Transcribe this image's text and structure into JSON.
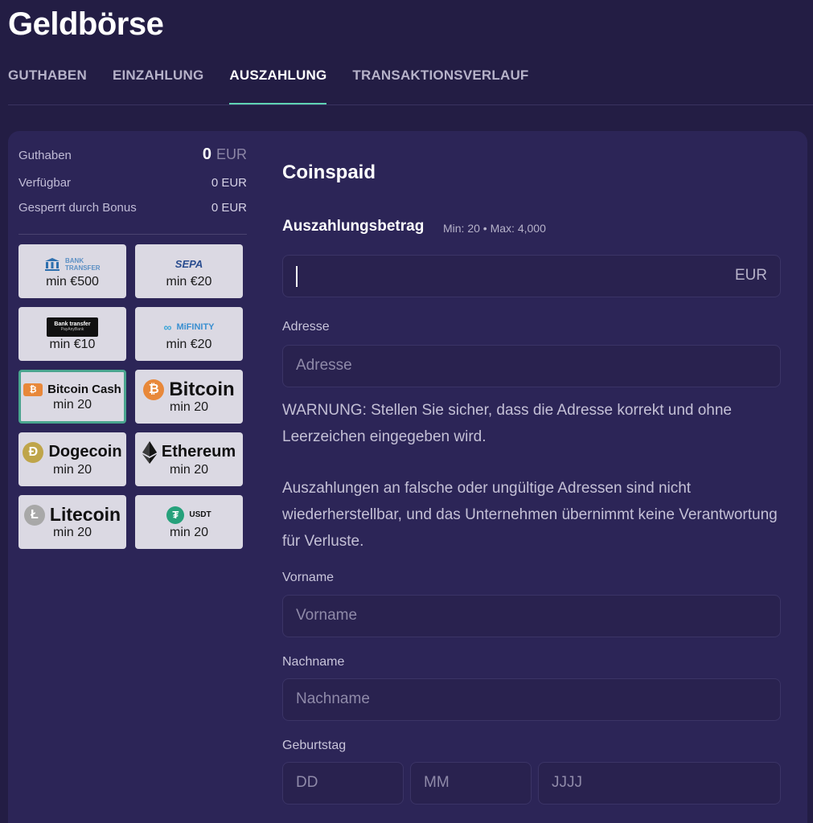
{
  "page_title": "Geldbörse",
  "tabs": [
    {
      "label": "GUTHABEN",
      "active": false
    },
    {
      "label": "EINZAHLUNG",
      "active": false
    },
    {
      "label": "AUSZAHLUNG",
      "active": true
    },
    {
      "label": "TRANSAKTIONSVERLAUF",
      "active": false
    }
  ],
  "balance": {
    "guthaben_label": "Guthaben",
    "guthaben_value": "0",
    "guthaben_currency": "EUR",
    "verfuegbar_label": "Verfügbar",
    "verfuegbar_value": "0 EUR",
    "gesperrt_label": "Gesperrt durch Bonus",
    "gesperrt_value": "0 EUR"
  },
  "methods": [
    {
      "name": "bank-transfer",
      "logo_text": "BANK TRANSFER",
      "min": "min €500",
      "selected": false
    },
    {
      "name": "sepa",
      "logo_text": "SEPA",
      "min": "min €20",
      "selected": false
    },
    {
      "name": "bank-transfer-payanybank",
      "logo_text": "Bank transfer",
      "logo_sub": "PayAnyBank",
      "min": "min €10",
      "selected": false
    },
    {
      "name": "mifinity",
      "logo_text": "MiFINITY",
      "min": "min €20",
      "selected": false
    },
    {
      "name": "bitcoin-cash",
      "logo_text": "Bitcoin Cash",
      "min": "min 20",
      "selected": true
    },
    {
      "name": "bitcoin",
      "logo_text": "Bitcoin",
      "min": "min 20",
      "selected": false
    },
    {
      "name": "dogecoin",
      "logo_text": "Dogecoin",
      "min": "min 20",
      "selected": false
    },
    {
      "name": "ethereum",
      "logo_text": "Ethereum",
      "min": "min 20",
      "selected": false
    },
    {
      "name": "litecoin",
      "logo_text": "Litecoin",
      "min": "min 20",
      "selected": false
    },
    {
      "name": "usdt",
      "logo_text": "USDT",
      "min": "min 20",
      "selected": false
    }
  ],
  "form": {
    "title": "Coinspaid",
    "amount_label": "Auszahlungsbetrag",
    "amount_limits": "Min: 20 • Max: 4,000",
    "amount_value": "",
    "amount_currency": "EUR",
    "address_label": "Adresse",
    "address_placeholder": "Adresse",
    "warning_1": "WARNUNG: Stellen Sie sicher, dass die Adresse korrekt und ohne Leerzeichen eingegeben wird.",
    "warning_2": "Auszahlungen an falsche oder ungültige Adressen sind nicht wiederherstellbar, und das Unternehmen übernimmt keine Verantwortung für Verluste.",
    "firstname_label": "Vorname",
    "firstname_placeholder": "Vorname",
    "lastname_label": "Nachname",
    "lastname_placeholder": "Nachname",
    "birthday_label": "Geburtstag",
    "day_placeholder": "DD",
    "month_placeholder": "MM",
    "year_placeholder": "JJJJ"
  },
  "colors": {
    "background": "#231d44",
    "panel": "#2c2557",
    "accent": "#5fd3b3",
    "selected_border": "#4aa58f"
  }
}
